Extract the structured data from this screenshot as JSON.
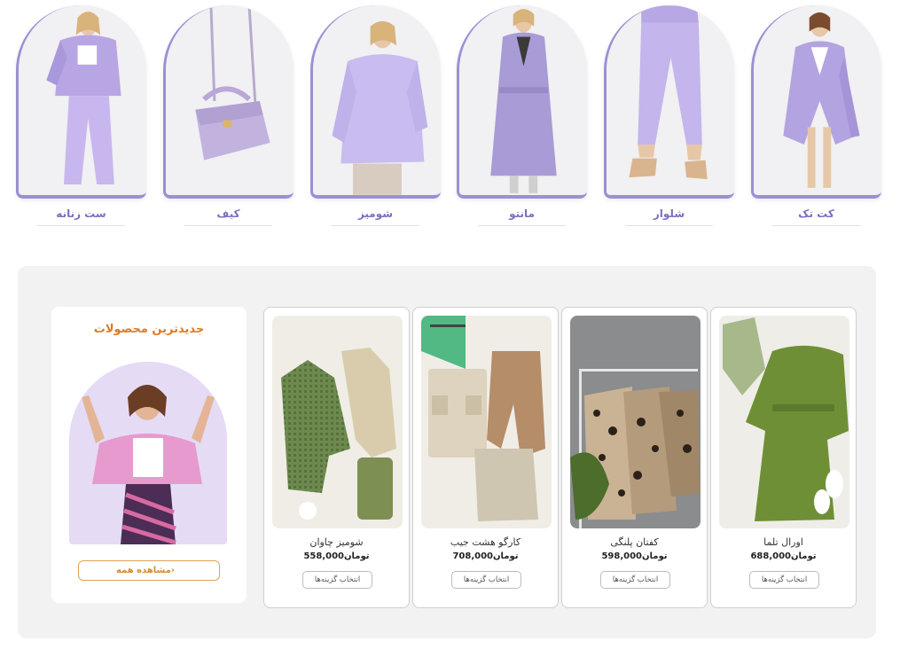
{
  "categories": [
    {
      "label": "کت تک"
    },
    {
      "label": "شلوار"
    },
    {
      "label": "مانتو"
    },
    {
      "label": "شومیز"
    },
    {
      "label": "کیف"
    },
    {
      "label": "ست زنانه"
    }
  ],
  "newest": {
    "title": "جدیدترین محصولات",
    "view_all_label": "مشاهده همه",
    "view_all_icon": "chevron-left-icon"
  },
  "products": [
    {
      "name": "اورال تلما",
      "price": "688,000تومان",
      "button": "انتخاب گزینه‌ها"
    },
    {
      "name": "کفتان پلنگی",
      "price": "598,000تومان",
      "button": "انتخاب گزینه‌ها"
    },
    {
      "name": "کارگو هشت جیب",
      "price": "708,000تومان",
      "button": "انتخاب گزینه‌ها"
    },
    {
      "name": "شومیز چاوان",
      "price": "558,000تومان",
      "button": "انتخاب گزینه‌ها"
    }
  ],
  "colors": {
    "category_accent": "#9b8fd6",
    "category_label": "#7b6fc0",
    "newest_title": "#e07a22",
    "view_all_border": "#e0a255",
    "panel_bg": "#f2f2f2"
  }
}
